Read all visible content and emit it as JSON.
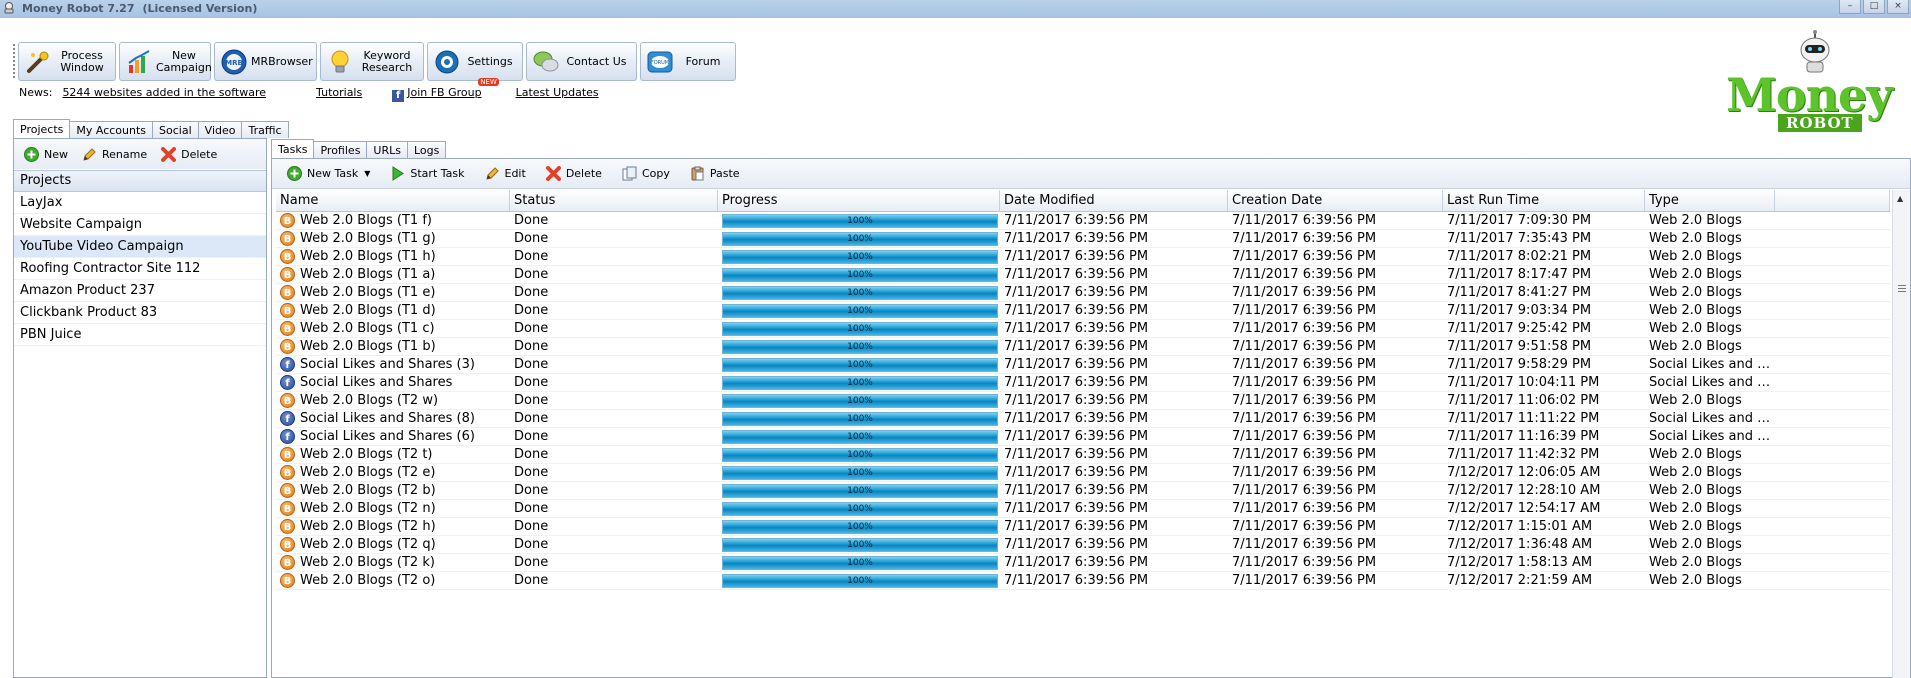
{
  "window": {
    "title": "Money Robot 7.27",
    "license": "(Licensed Version)"
  },
  "toolbar": [
    {
      "label": "Process\nWindow",
      "icon": "magic-wand-icon",
      "width": 98
    },
    {
      "label": "New\nCampaign",
      "icon": "bar-chart-icon",
      "width": 92
    },
    {
      "label": "MRBrowser",
      "icon": "browser-globe-icon",
      "width": 103
    },
    {
      "label": "Keyword\nResearch",
      "icon": "lightbulb-icon",
      "width": 104
    },
    {
      "label": "Settings",
      "icon": "settings-swirl-icon",
      "width": 96
    },
    {
      "label": "Contact Us",
      "icon": "chat-bubbles-icon",
      "width": 111
    },
    {
      "label": "Forum",
      "icon": "forum-icon",
      "width": 96
    }
  ],
  "news": {
    "label": "News:",
    "headline": "5244 websites added in the software",
    "tutorials": "Tutorials",
    "fb_group": "Join FB Group",
    "new_badge": "NEW",
    "latest": "Latest Updates"
  },
  "logo": {
    "money": "Money",
    "robot": "ROBOT"
  },
  "left_tabs": [
    "Projects",
    "My Accounts",
    "Social",
    "Video",
    "Traffic"
  ],
  "left_toolbar": {
    "new": "New",
    "rename": "Rename",
    "delete": "Delete"
  },
  "projects": {
    "header": "Projects",
    "items": [
      "LayJax",
      "Website Campaign",
      "YouTube Video Campaign",
      "Roofing Contractor Site 112",
      "Amazon Product 237",
      "Clickbank Product 83",
      "PBN Juice"
    ],
    "selected_index": 2
  },
  "right_tabs": [
    "Tasks",
    "Profiles",
    "URLs",
    "Logs"
  ],
  "right_toolbar": {
    "new_task": "New Task",
    "start_task": "Start Task",
    "edit": "Edit",
    "delete": "Delete",
    "copy": "Copy",
    "paste": "Paste"
  },
  "table": {
    "columns": [
      "Name",
      "Status",
      "Progress",
      "Date Modified",
      "Creation Date",
      "Last Run Time",
      "Type",
      ""
    ],
    "rows": [
      {
        "icon": "blog",
        "name": "Web 2.0 Blogs (T1 f)",
        "status": "Done",
        "progress": "100%",
        "modified": "7/11/2017 6:39:56 PM",
        "created": "7/11/2017 6:39:56 PM",
        "last_run": "7/11/2017 7:09:30 PM",
        "type": "Web 2.0 Blogs"
      },
      {
        "icon": "blog",
        "name": "Web 2.0 Blogs (T1 g)",
        "status": "Done",
        "progress": "100%",
        "modified": "7/11/2017 6:39:56 PM",
        "created": "7/11/2017 6:39:56 PM",
        "last_run": "7/11/2017 7:35:43 PM",
        "type": "Web 2.0 Blogs"
      },
      {
        "icon": "blog",
        "name": "Web 2.0 Blogs (T1 h)",
        "status": "Done",
        "progress": "100%",
        "modified": "7/11/2017 6:39:56 PM",
        "created": "7/11/2017 6:39:56 PM",
        "last_run": "7/11/2017 8:02:21 PM",
        "type": "Web 2.0 Blogs"
      },
      {
        "icon": "blog",
        "name": "Web 2.0 Blogs (T1 a)",
        "status": "Done",
        "progress": "100%",
        "modified": "7/11/2017 6:39:56 PM",
        "created": "7/11/2017 6:39:56 PM",
        "last_run": "7/11/2017 8:17:47 PM",
        "type": "Web 2.0 Blogs"
      },
      {
        "icon": "blog",
        "name": "Web 2.0 Blogs (T1 e)",
        "status": "Done",
        "progress": "100%",
        "modified": "7/11/2017 6:39:56 PM",
        "created": "7/11/2017 6:39:56 PM",
        "last_run": "7/11/2017 8:41:27 PM",
        "type": "Web 2.0 Blogs"
      },
      {
        "icon": "blog",
        "name": "Web 2.0 Blogs (T1 d)",
        "status": "Done",
        "progress": "100%",
        "modified": "7/11/2017 6:39:56 PM",
        "created": "7/11/2017 6:39:56 PM",
        "last_run": "7/11/2017 9:03:34 PM",
        "type": "Web 2.0 Blogs"
      },
      {
        "icon": "blog",
        "name": "Web 2.0 Blogs (T1 c)",
        "status": "Done",
        "progress": "100%",
        "modified": "7/11/2017 6:39:56 PM",
        "created": "7/11/2017 6:39:56 PM",
        "last_run": "7/11/2017 9:25:42 PM",
        "type": "Web 2.0 Blogs"
      },
      {
        "icon": "blog",
        "name": "Web 2.0 Blogs (T1 b)",
        "status": "Done",
        "progress": "100%",
        "modified": "7/11/2017 6:39:56 PM",
        "created": "7/11/2017 6:39:56 PM",
        "last_run": "7/11/2017 9:51:58 PM",
        "type": "Web 2.0 Blogs"
      },
      {
        "icon": "social",
        "name": "Social Likes and Shares (3)",
        "status": "Done",
        "progress": "100%",
        "modified": "7/11/2017 6:39:56 PM",
        "created": "7/11/2017 6:39:56 PM",
        "last_run": "7/11/2017 9:58:29 PM",
        "type": "Social Likes and Shares"
      },
      {
        "icon": "social",
        "name": "Social Likes and Shares",
        "status": "Done",
        "progress": "100%",
        "modified": "7/11/2017 6:39:56 PM",
        "created": "7/11/2017 6:39:56 PM",
        "last_run": "7/11/2017 10:04:11 PM",
        "type": "Social Likes and Shares"
      },
      {
        "icon": "blog",
        "name": "Web 2.0 Blogs (T2 w)",
        "status": "Done",
        "progress": "100%",
        "modified": "7/11/2017 6:39:56 PM",
        "created": "7/11/2017 6:39:56 PM",
        "last_run": "7/11/2017 11:06:02 PM",
        "type": "Web 2.0 Blogs"
      },
      {
        "icon": "social",
        "name": "Social Likes and Shares (8)",
        "status": "Done",
        "progress": "100%",
        "modified": "7/11/2017 6:39:56 PM",
        "created": "7/11/2017 6:39:56 PM",
        "last_run": "7/11/2017 11:11:22 PM",
        "type": "Social Likes and Shares"
      },
      {
        "icon": "social",
        "name": "Social Likes and Shares (6)",
        "status": "Done",
        "progress": "100%",
        "modified": "7/11/2017 6:39:56 PM",
        "created": "7/11/2017 6:39:56 PM",
        "last_run": "7/11/2017 11:16:39 PM",
        "type": "Social Likes and Shares"
      },
      {
        "icon": "blog",
        "name": "Web 2.0 Blogs (T2 t)",
        "status": "Done",
        "progress": "100%",
        "modified": "7/11/2017 6:39:56 PM",
        "created": "7/11/2017 6:39:56 PM",
        "last_run": "7/11/2017 11:42:32 PM",
        "type": "Web 2.0 Blogs"
      },
      {
        "icon": "blog",
        "name": "Web 2.0 Blogs (T2 e)",
        "status": "Done",
        "progress": "100%",
        "modified": "7/11/2017 6:39:56 PM",
        "created": "7/11/2017 6:39:56 PM",
        "last_run": "7/12/2017 12:06:05 AM",
        "type": "Web 2.0 Blogs"
      },
      {
        "icon": "blog",
        "name": "Web 2.0 Blogs (T2 b)",
        "status": "Done",
        "progress": "100%",
        "modified": "7/11/2017 6:39:56 PM",
        "created": "7/11/2017 6:39:56 PM",
        "last_run": "7/12/2017 12:28:10 AM",
        "type": "Web 2.0 Blogs"
      },
      {
        "icon": "blog",
        "name": "Web 2.0 Blogs (T2 n)",
        "status": "Done",
        "progress": "100%",
        "modified": "7/11/2017 6:39:56 PM",
        "created": "7/11/2017 6:39:56 PM",
        "last_run": "7/12/2017 12:54:17 AM",
        "type": "Web 2.0 Blogs"
      },
      {
        "icon": "blog",
        "name": "Web 2.0 Blogs (T2 h)",
        "status": "Done",
        "progress": "100%",
        "modified": "7/11/2017 6:39:56 PM",
        "created": "7/11/2017 6:39:56 PM",
        "last_run": "7/12/2017 1:15:01 AM",
        "type": "Web 2.0 Blogs"
      },
      {
        "icon": "blog",
        "name": "Web 2.0 Blogs (T2 q)",
        "status": "Done",
        "progress": "100%",
        "modified": "7/11/2017 6:39:56 PM",
        "created": "7/11/2017 6:39:56 PM",
        "last_run": "7/12/2017 1:36:48 AM",
        "type": "Web 2.0 Blogs"
      },
      {
        "icon": "blog",
        "name": "Web 2.0 Blogs (T2 k)",
        "status": "Done",
        "progress": "100%",
        "modified": "7/11/2017 6:39:56 PM",
        "created": "7/11/2017 6:39:56 PM",
        "last_run": "7/12/2017 1:58:13 AM",
        "type": "Web 2.0 Blogs"
      },
      {
        "icon": "blog",
        "name": "Web 2.0 Blogs (T2 o)",
        "status": "Done",
        "progress": "100%",
        "modified": "7/11/2017 6:39:56 PM",
        "created": "7/11/2017 6:39:56 PM",
        "last_run": "7/12/2017 2:21:59 AM",
        "type": "Web 2.0 Blogs"
      }
    ]
  }
}
